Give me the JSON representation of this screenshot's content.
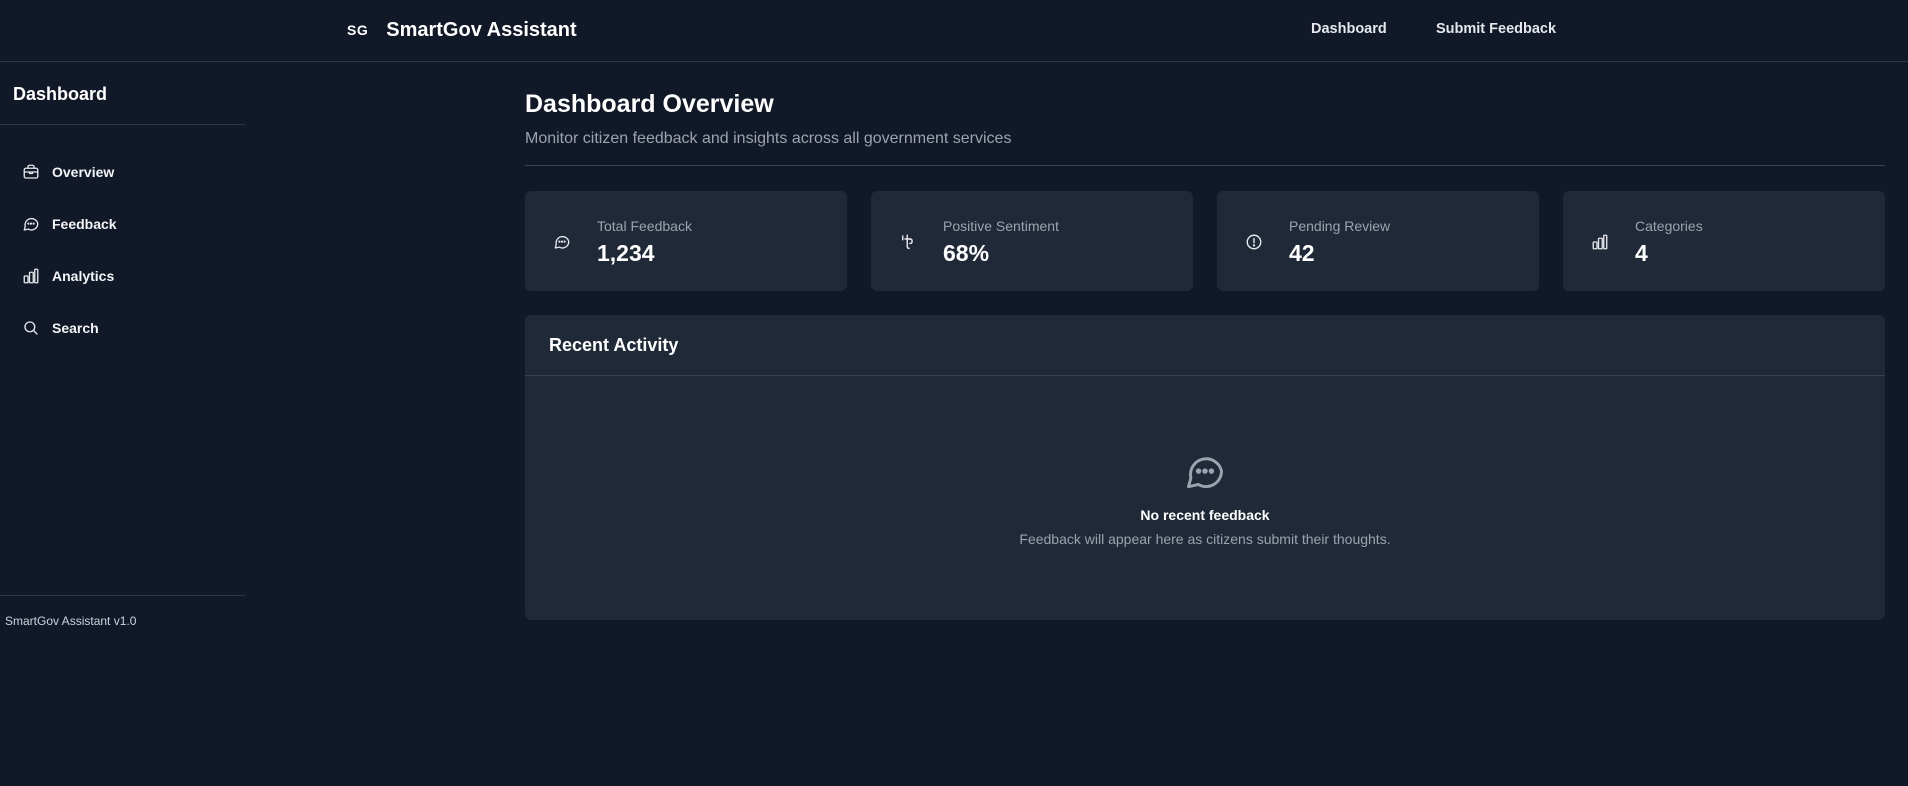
{
  "header": {
    "logo": "SG",
    "app_name": "SmartGov Assistant",
    "nav": {
      "dashboard": "Dashboard",
      "submit_feedback": "Submit Feedback"
    }
  },
  "sidebar": {
    "title": "Dashboard",
    "items": [
      {
        "label": "Overview",
        "icon": "briefcase-icon"
      },
      {
        "label": "Feedback",
        "icon": "message-circle-icon"
      },
      {
        "label": "Analytics",
        "icon": "bar-chart-icon"
      },
      {
        "label": "Search",
        "icon": "search-icon"
      }
    ],
    "version": "SmartGov Assistant v1.0"
  },
  "main": {
    "title": "Dashboard Overview",
    "subtitle": "Monitor citizen feedback and insights across all government services",
    "stats": [
      {
        "label": "Total Feedback",
        "value": "1,234",
        "icon": "message-circle-icon"
      },
      {
        "label": "Positive Sentiment",
        "value": "68%",
        "icon": "thumbs-up-icon"
      },
      {
        "label": "Pending Review",
        "value": "42",
        "icon": "alert-circle-icon"
      },
      {
        "label": "Categories",
        "value": "4",
        "icon": "bar-chart-icon"
      }
    ],
    "activity": {
      "title": "Recent Activity",
      "empty_title": "No recent feedback",
      "empty_subtitle": "Feedback will appear here as citizens submit their thoughts.",
      "empty_icon": "message-dots-icon"
    }
  },
  "colors": {
    "background": "#111827",
    "card": "#1f2937",
    "muted_text": "#9ca3af",
    "border": "#2d3748"
  }
}
